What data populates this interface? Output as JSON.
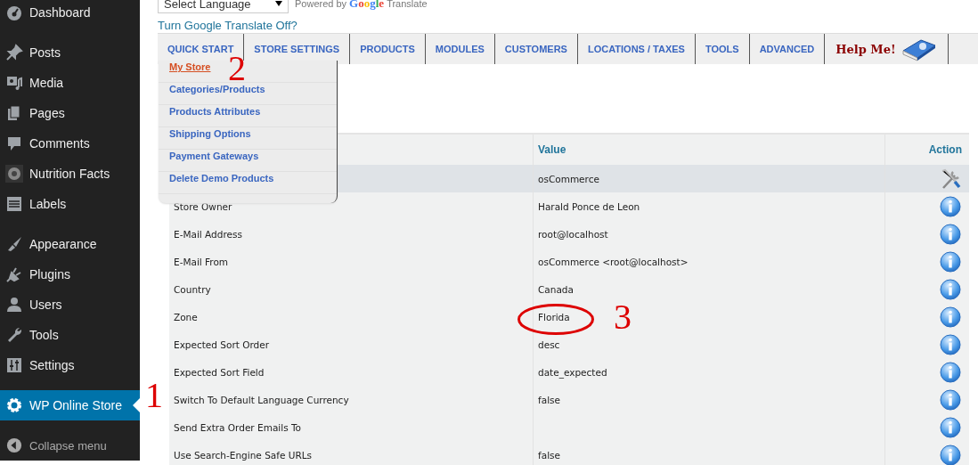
{
  "sidebar": {
    "groups": [
      {
        "items": [
          {
            "label": "Dashboard",
            "selected": false
          }
        ]
      },
      {
        "items": [
          {
            "label": "Posts",
            "selected": false
          },
          {
            "label": "Media",
            "selected": false
          },
          {
            "label": "Pages",
            "selected": false
          },
          {
            "label": "Comments",
            "selected": false
          },
          {
            "label": "Nutrition Facts",
            "selected": false
          },
          {
            "label": "Labels",
            "selected": false
          }
        ]
      },
      {
        "items": [
          {
            "label": "Appearance",
            "selected": false
          },
          {
            "label": "Plugins",
            "selected": false
          },
          {
            "label": "Users",
            "selected": false
          },
          {
            "label": "Tools",
            "selected": false
          },
          {
            "label": "Settings",
            "selected": false
          }
        ]
      },
      {
        "items": [
          {
            "label": "WP Online Store",
            "selected": true
          }
        ]
      }
    ],
    "collapse_label": "Collapse menu"
  },
  "translate": {
    "language_select": "Select Language",
    "powered_by": "Powered by",
    "brand": "Google",
    "product": "Translate",
    "toggle_link": "Turn Google Translate Off?"
  },
  "tabs": [
    {
      "label": "QUICK START",
      "kind": "text"
    },
    {
      "label": "STORE SETTINGS",
      "kind": "text"
    },
    {
      "label": "PRODUCTS",
      "kind": "text"
    },
    {
      "label": "MODULES",
      "kind": "text"
    },
    {
      "label": "CUSTOMERS",
      "kind": "text"
    },
    {
      "label": "LOCATIONS / TAXES",
      "kind": "text"
    },
    {
      "label": "TOOLS",
      "kind": "text"
    },
    {
      "label": "ADVANCED",
      "kind": "text"
    },
    {
      "label": "Help Me!",
      "kind": "help"
    }
  ],
  "quick_menu": {
    "items": [
      {
        "label": "My Store",
        "selected": true
      },
      {
        "label": "Categories/Products",
        "selected": false
      },
      {
        "label": "Products Attributes",
        "selected": false
      },
      {
        "label": "Shipping Options",
        "selected": false
      },
      {
        "label": "Payment Gateways",
        "selected": false
      },
      {
        "label": "Delete Demo Products",
        "selected": false
      }
    ]
  },
  "table": {
    "columns": [
      "Value",
      "Action"
    ],
    "rows": [
      {
        "value": "osCommerce",
        "kind": "edit",
        "selected": true
      },
      {
        "title": "Store Owner",
        "value": "Harald Ponce de Leon",
        "kind": "info",
        "selected": false
      },
      {
        "title": "E-Mail Address",
        "value": "root@localhost",
        "kind": "info",
        "selected": false
      },
      {
        "title": "E-Mail From",
        "value": "osCommerce <root@localhost>",
        "kind": "info",
        "selected": false
      },
      {
        "title": "Country",
        "value": "Canada",
        "kind": "info",
        "selected": false
      },
      {
        "title": "Zone",
        "value": "Florida",
        "kind": "info",
        "selected": false
      },
      {
        "title": "Expected Sort Order",
        "value": "desc",
        "kind": "info",
        "selected": false
      },
      {
        "title": "Expected Sort Field",
        "value": "date_expected",
        "kind": "info",
        "selected": false
      },
      {
        "title": "Switch To Default Language Currency",
        "value": "false",
        "kind": "info",
        "selected": false
      },
      {
        "title": "Send Extra Order Emails To",
        "kind": "info",
        "selected": false
      },
      {
        "title": "Use Search-Engine Safe URLs",
        "value": "false",
        "kind": "info",
        "selected": false
      }
    ]
  },
  "annotations": [
    {
      "label": "1",
      "kind": "number"
    },
    {
      "label": "2",
      "kind": "number"
    },
    {
      "label": "3",
      "kind": "number"
    },
    {
      "kind": "ellipse"
    }
  ]
}
